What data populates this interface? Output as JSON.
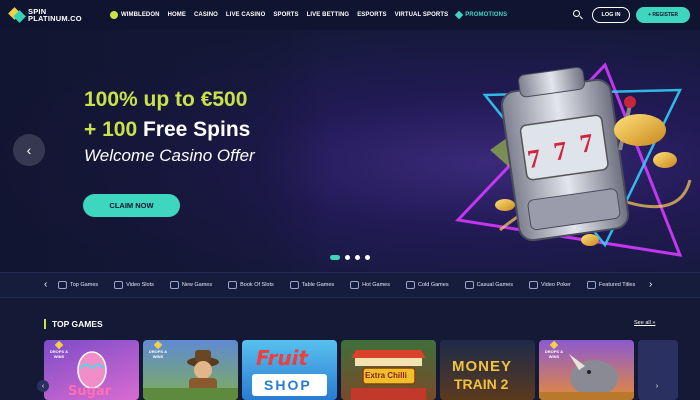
{
  "header": {
    "logo_line1": "SPIN",
    "logo_line2": "PLATINUM.CO",
    "nav": [
      {
        "label": "WIMBLEDON",
        "icon": "tennis-ball-icon"
      },
      {
        "label": "HOME"
      },
      {
        "label": "CASINO"
      },
      {
        "label": "LIVE CASINO"
      },
      {
        "label": "SPORTS"
      },
      {
        "label": "LIVE BETTING"
      },
      {
        "label": "ESPORTS"
      },
      {
        "label": "VIRTUAL SPORTS"
      },
      {
        "label": "PROMOTIONS",
        "icon": "promotions-icon"
      }
    ],
    "login_label": "LOG IN",
    "register_label": "+ REGISTER"
  },
  "hero": {
    "line1": "100% up to €500",
    "line2_accent": "+ 100",
    "line2_rest": " Free Spins",
    "subtitle": "Welcome Casino Offer",
    "cta": "CLAIM NOW",
    "prev_arrow": "‹",
    "slides_total": 4,
    "active_slide": 1
  },
  "categories": {
    "prev_arrow": "‹",
    "next_arrow": "›",
    "items": [
      {
        "label": "Top Games"
      },
      {
        "label": "Video Slots"
      },
      {
        "label": "New Games"
      },
      {
        "label": "Book Of Slots"
      },
      {
        "label": "Table Games"
      },
      {
        "label": "Hot Games"
      },
      {
        "label": "Cold Games"
      },
      {
        "label": "Casual Games"
      },
      {
        "label": "Video Poker"
      },
      {
        "label": "Featured Titles"
      }
    ]
  },
  "top_games": {
    "title": "TOP GAMES",
    "see_all": "See all »",
    "prev_arrow": "‹",
    "next_arrow": "›",
    "drops_badge": "DROPS & WINS",
    "games": [
      {
        "title": "Sugar",
        "drops": true
      },
      {
        "title": "",
        "drops": true
      },
      {
        "title": "Fruit Shop",
        "title_top": "Fruit",
        "title_bottom": "SHOP",
        "drops": false
      },
      {
        "title": "Extra Chilli",
        "drops": false
      },
      {
        "title": "Money Train 2",
        "title_top": "MONEY",
        "title_bottom": "TRAIN 2",
        "drops": false
      },
      {
        "title": "",
        "drops": true
      }
    ]
  },
  "colors": {
    "accent_teal": "#3fd6bf",
    "accent_lime": "#c9e24a",
    "bg_dark": "#141a36"
  }
}
